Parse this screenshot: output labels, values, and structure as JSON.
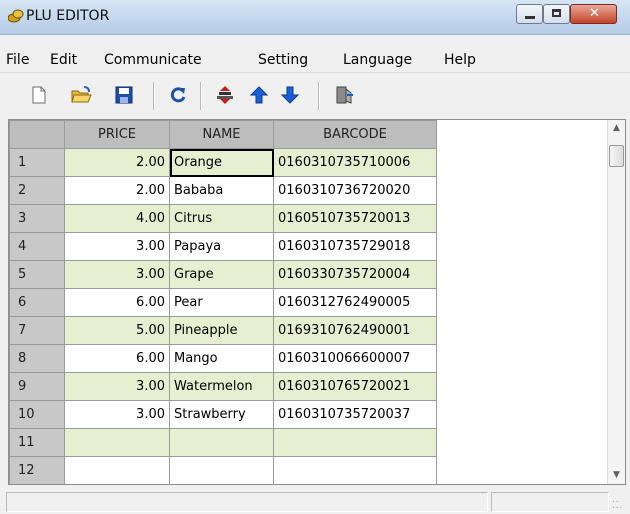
{
  "window": {
    "title": "PLU EDITOR"
  },
  "menu": [
    "File",
    "Edit",
    "Communicate",
    "Setting",
    "Language",
    "Help"
  ],
  "toolbar": {
    "icons": [
      "new-file-icon",
      "open-folder-icon",
      "save-disk-icon",
      "refresh-icon",
      "transfer-icon",
      "arrow-up-icon",
      "arrow-down-icon",
      "exit-icon"
    ]
  },
  "grid": {
    "columns": [
      "PRICE",
      "NAME",
      "BARCODE"
    ],
    "rows": [
      {
        "no": "1",
        "price": "2.00",
        "name": "Orange",
        "barcode": "0160310735710006"
      },
      {
        "no": "2",
        "price": "2.00",
        "name": "Bababa",
        "barcode": "0160310736720020"
      },
      {
        "no": "3",
        "price": "4.00",
        "name": "Citrus",
        "barcode": "0160510735720013"
      },
      {
        "no": "4",
        "price": "3.00",
        "name": "Papaya",
        "barcode": "0160310735729018"
      },
      {
        "no": "5",
        "price": "3.00",
        "name": "Grape",
        "barcode": "0160330735720004"
      },
      {
        "no": "6",
        "price": "6.00",
        "name": "Pear",
        "barcode": "0160312762490005"
      },
      {
        "no": "7",
        "price": "5.00",
        "name": "Pineapple",
        "barcode": "0169310762490001"
      },
      {
        "no": "8",
        "price": "6.00",
        "name": "Mango",
        "barcode": "0160310066600007"
      },
      {
        "no": "9",
        "price": "3.00",
        "name": "Watermelon",
        "barcode": "0160310765720021"
      },
      {
        "no": "10",
        "price": "3.00",
        "name": "Strawberry",
        "barcode": "0160310735720037"
      },
      {
        "no": "11",
        "price": "",
        "name": "",
        "barcode": ""
      },
      {
        "no": "12",
        "price": "",
        "name": "",
        "barcode": ""
      }
    ]
  },
  "colors": {
    "row_alt": "#e6f0d0",
    "header": "#bdbdbd",
    "arrow_blue": "#1a5fd8"
  }
}
